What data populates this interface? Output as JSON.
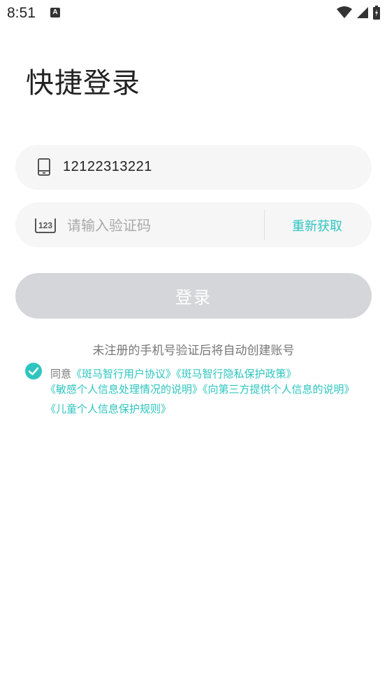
{
  "status_bar": {
    "time": "8:51",
    "notification_icon": "A"
  },
  "title": "快捷登录",
  "phone": {
    "value": "12122313221"
  },
  "code": {
    "placeholder": "请输入验证码",
    "resend_label": "重新获取"
  },
  "login_label": "登录",
  "notice": "未注册的手机号验证后将自动创建账号",
  "agreement": {
    "prefix": "同意",
    "links": [
      "《斑马智行用户协议》",
      "《斑马智行隐私保护政策》",
      "《敏感个人信息处理情况的说明》",
      "《向第三方提供个人信息的说明》",
      "《儿童个人信息保护规则》"
    ]
  },
  "colors": {
    "accent": "#2ec5c0",
    "button_disabled": "#d4d6da",
    "field_bg": "#f6f6f6"
  }
}
